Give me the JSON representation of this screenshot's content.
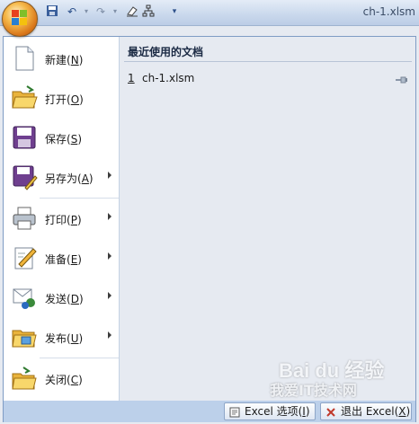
{
  "window": {
    "title": "ch-1.xlsm"
  },
  "quick_access": {
    "icons": [
      "save-icon",
      "undo-icon",
      "redo-icon",
      "clear-icon",
      "diagram-icon",
      "customize-dropdown-icon"
    ]
  },
  "menu": {
    "items": [
      {
        "label": "新建",
        "hotkey": "N",
        "icon": "new-document-icon",
        "submenu": false
      },
      {
        "label": "打开",
        "hotkey": "O",
        "icon": "open-folder-icon",
        "submenu": false
      },
      {
        "label": "保存",
        "hotkey": "S",
        "icon": "save-disk-icon",
        "submenu": false
      },
      {
        "label": "另存为",
        "hotkey": "A",
        "icon": "save-as-icon",
        "submenu": true
      },
      {
        "label": "打印",
        "hotkey": "P",
        "icon": "printer-icon",
        "submenu": true
      },
      {
        "label": "准备",
        "hotkey": "E",
        "icon": "prepare-icon",
        "submenu": true
      },
      {
        "label": "发送",
        "hotkey": "D",
        "icon": "send-icon",
        "submenu": true
      },
      {
        "label": "发布",
        "hotkey": "U",
        "icon": "publish-folder-icon",
        "submenu": true
      },
      {
        "label": "关闭",
        "hotkey": "C",
        "icon": "close-folder-icon",
        "submenu": false
      }
    ]
  },
  "recent": {
    "title": "最近使用的文档",
    "items": [
      {
        "number": "1",
        "name": "ch-1.xlsm",
        "icon": "pin-icon"
      }
    ]
  },
  "buttons": {
    "options": {
      "prefix": "Excel 选项(",
      "hotkey": "I",
      "suffix": ")"
    },
    "exit": {
      "prefix": "退出 Excel(",
      "hotkey": "X",
      "suffix": ")"
    }
  },
  "watermark": {
    "line1": "Bai du 经验",
    "line2": "我爱IT技术网"
  }
}
